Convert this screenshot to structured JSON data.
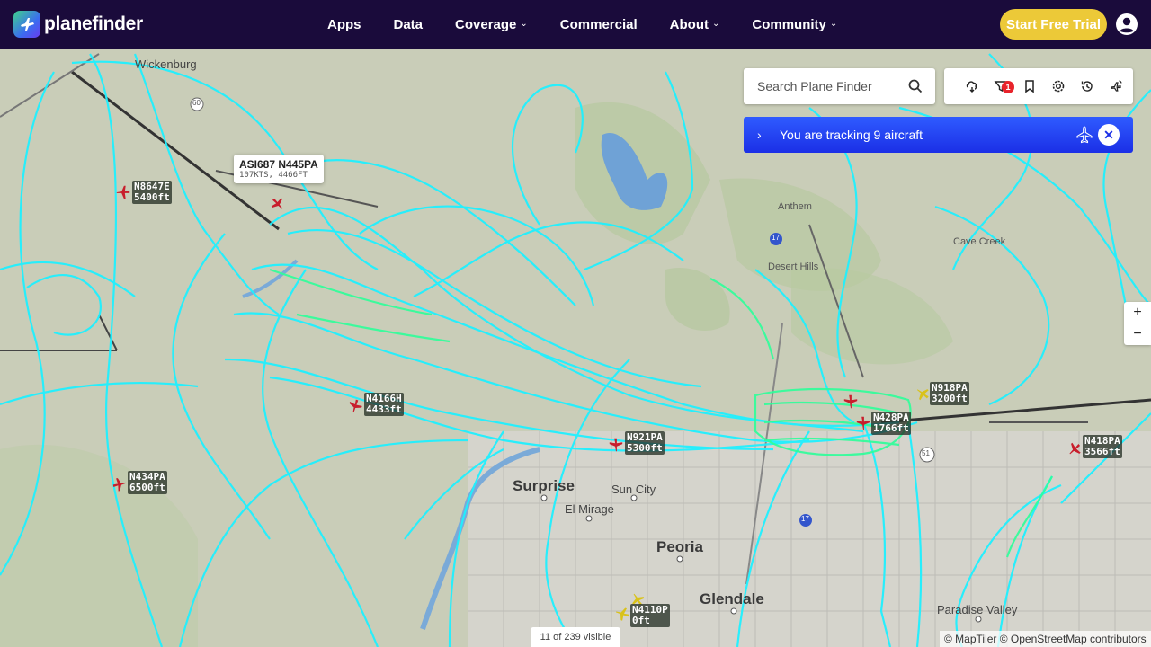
{
  "brand": {
    "name": "planefinder"
  },
  "nav": {
    "items": [
      {
        "label": "Apps",
        "dropdown": false
      },
      {
        "label": "Data",
        "dropdown": false
      },
      {
        "label": "Coverage",
        "dropdown": true
      },
      {
        "label": "Commercial",
        "dropdown": false
      },
      {
        "label": "About",
        "dropdown": true
      },
      {
        "label": "Community",
        "dropdown": true
      }
    ],
    "cta": "Start Free Trial"
  },
  "search": {
    "placeholder": "Search Plane Finder"
  },
  "toolbar": {
    "icons": [
      "weather-icon",
      "filter-icon",
      "bookmark-icon",
      "settings-icon",
      "history-icon",
      "live-icon"
    ],
    "filter_badge": "1"
  },
  "tracking_banner": {
    "text": "You are tracking 9 aircraft"
  },
  "selected_popup": {
    "title": "ASI687 N445PA",
    "subtitle": "107KTS, 4466FT"
  },
  "aircraft": [
    {
      "callsign": "N8647E",
      "altitude": "5400ft",
      "color": "#c81e2c"
    },
    {
      "callsign": "N4166H",
      "altitude": "4433ft",
      "color": "#c81e2c"
    },
    {
      "callsign": "N434PA",
      "altitude": "6500ft",
      "color": "#c81e2c"
    },
    {
      "callsign": "N921PA",
      "altitude": "5300ft",
      "color": "#c81e2c"
    },
    {
      "callsign": "N918PA",
      "altitude": "3200ft",
      "color": "#d9c21b"
    },
    {
      "callsign": "N428PA",
      "altitude": "1766ft",
      "color": "#c81e2c"
    },
    {
      "callsign": "N418PA",
      "altitude": "3566ft",
      "color": "#c81e2c"
    },
    {
      "callsign": "N4110P",
      "altitude": "0ft",
      "color": "#d9c21b"
    }
  ],
  "places": {
    "wickenburg": "Wickenburg",
    "surprise": "Surprise",
    "sun_city": "Sun City",
    "el_mirage": "El Mirage",
    "peoria": "Peoria",
    "glendale": "Glendale",
    "paradise_valley": "Paradise Valley",
    "anthem": "Anthem",
    "desert_hills": "Desert Hills",
    "cave_creek": "Cave Creek",
    "route_60": "60",
    "route_17a": "17",
    "route_17b": "17",
    "route_51": "51"
  },
  "map_status": {
    "visible": "11 of 239 visible"
  },
  "attribution": "© MapTiler © OpenStreetMap contributors",
  "colors": {
    "track": "#1ff0ff",
    "track_low": "#2dff9a",
    "nav_bg": "#1a0b3b",
    "cta": "#ecc938",
    "banner": "#2346f5"
  }
}
